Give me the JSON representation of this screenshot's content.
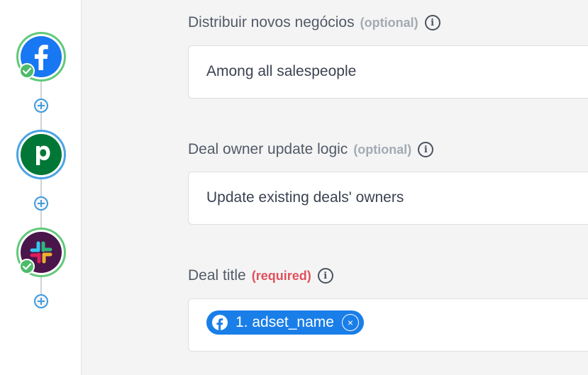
{
  "workflow": {
    "steps": [
      {
        "app": "Facebook",
        "icon": "facebook-icon",
        "status": "complete",
        "brand_color": "#1877f2"
      },
      {
        "app": "Pipedrive",
        "icon": "pipedrive-icon",
        "status": "active",
        "brand_color": "#017737",
        "letter": "p"
      },
      {
        "app": "Slack",
        "icon": "slack-icon",
        "status": "complete",
        "brand_color": "#4a154b"
      }
    ]
  },
  "fields": [
    {
      "label": "Distribuir novos negócios",
      "tag": "(optional)",
      "value": "Among all salespeople"
    },
    {
      "label": "Deal owner update logic",
      "tag": "(optional)",
      "value": "Update existing deals' owners"
    },
    {
      "label": "Deal title",
      "tag": "(required)",
      "chip": {
        "text": "1. adset_name",
        "icon": "facebook-icon",
        "remove": "×"
      }
    }
  ],
  "info_glyph": "i",
  "colors": {
    "success": "#4dbb6b",
    "accent": "#1a7ee8",
    "required": "#e0505d",
    "optional": "#a3aab3"
  }
}
